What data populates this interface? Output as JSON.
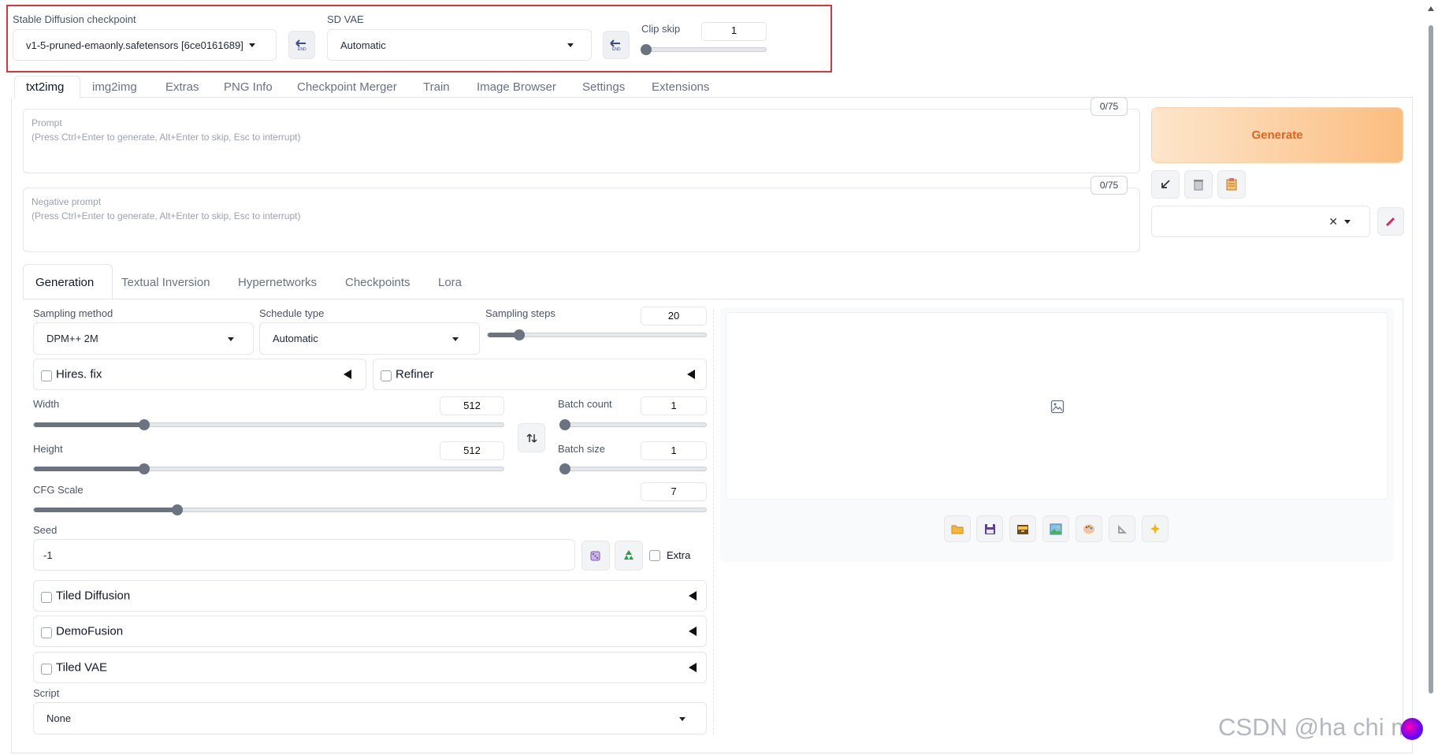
{
  "top": {
    "checkpoint_label": "Stable Diffusion checkpoint",
    "checkpoint_value": "v1-5-pruned-emaonly.safetensors [6ce0161689]",
    "vae_label": "SD VAE",
    "vae_value": "Automatic",
    "clip_skip_label": "Clip skip",
    "clip_skip_value": "1",
    "clip_skip_fraction": 0
  },
  "main_tabs": [
    "txt2img",
    "img2img",
    "Extras",
    "PNG Info",
    "Checkpoint Merger",
    "Train",
    "Image Browser",
    "Settings",
    "Extensions"
  ],
  "prompt": {
    "label": "Prompt",
    "hint": "(Press Ctrl+Enter to generate, Alt+Enter to skip, Esc to interrupt)",
    "counter": "0/75"
  },
  "negative_prompt": {
    "label": "Negative prompt",
    "hint": "(Press Ctrl+Enter to generate, Alt+Enter to skip, Esc to interrupt)",
    "counter": "0/75"
  },
  "generate_label": "Generate",
  "sub_tabs": [
    "Generation",
    "Textual Inversion",
    "Hypernetworks",
    "Checkpoints",
    "Lora"
  ],
  "generation": {
    "sampling_method_label": "Sampling method",
    "sampling_method_value": "DPM++ 2M",
    "schedule_type_label": "Schedule type",
    "schedule_type_value": "Automatic",
    "sampling_steps_label": "Sampling steps",
    "sampling_steps_value": "20",
    "hires_fix_label": "Hires. fix",
    "refiner_label": "Refiner",
    "width_label": "Width",
    "width_value": "512",
    "height_label": "Height",
    "height_value": "512",
    "batch_count_label": "Batch count",
    "batch_count_value": "1",
    "batch_size_label": "Batch size",
    "batch_size_value": "1",
    "cfg_label": "CFG Scale",
    "cfg_value": "7",
    "seed_label": "Seed",
    "seed_value": "-1",
    "extra_label": "Extra",
    "tiled_diffusion_label": "Tiled Diffusion",
    "demofusion_label": "DemoFusion",
    "tiled_vae_label": "Tiled VAE",
    "script_label": "Script",
    "script_value": "None"
  },
  "watermark": "CSDN @ha chi mi",
  "colors": {
    "highlight_border": "#d9363e",
    "generate_gradient_start": "#fde4c8",
    "generate_gradient_end": "#fbbd80",
    "generate_text": "#e0651f",
    "slider_fill": "#6b7280"
  },
  "icons": {
    "swap_dims": "swap-vertical-icon",
    "refresh_vae": "refresh-icon",
    "dice": "dice-icon",
    "recycle": "recycle-icon",
    "image_placeholder": "image-icon"
  }
}
